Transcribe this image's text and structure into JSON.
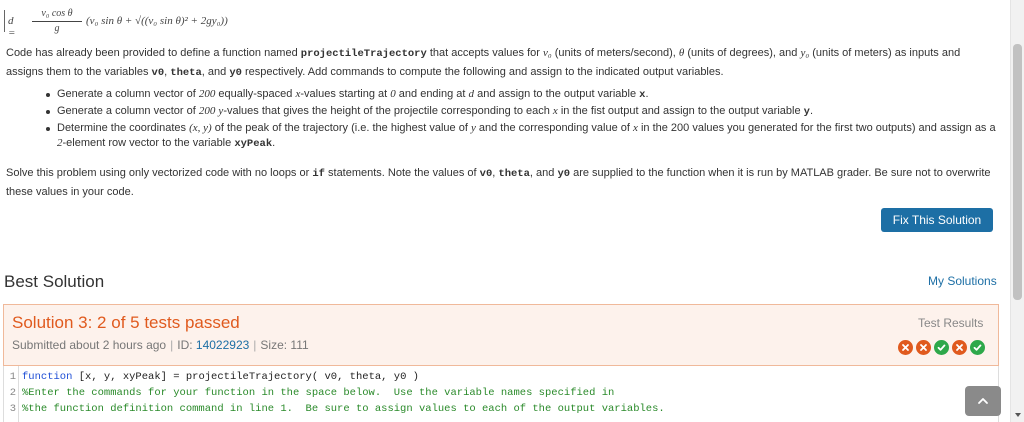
{
  "formula": {
    "lhs": "d =",
    "numerator": "v₀ cos θ",
    "denominator": "g",
    "rest": "(v₀ sin θ + √((v₀ sin θ)² + 2gy₀))"
  },
  "intro": {
    "t1": "Code has already been provided to define a function named ",
    "fname": "projectileTrajectory",
    "t2": " that accepts values for ",
    "m1": "v₀",
    "t3": " (units of meters/second), ",
    "m2": "θ",
    "t4": " (units of degrees), and ",
    "m3": "y₀",
    "t5": " (units of meters) as inputs and assigns them to the variables ",
    "c1": "v0",
    "t6": ", ",
    "c2": "theta",
    "t7": ", and ",
    "c3": "y0",
    "t8": " respectively.  Add commands to compute the following and assign to the indicated output variables."
  },
  "bullets": [
    {
      "a": "Generate a column vector of ",
      "m1": "200",
      "b": " equally-spaced ",
      "m2": "x",
      "c": "-values starting at ",
      "m3": "0",
      "d": " and ending at ",
      "m4": "d",
      "e": " and assign to the output variable ",
      "code": "x",
      "f": "."
    },
    {
      "a": "Generate a column vector of ",
      "m1": "200",
      "b": " ",
      "m2": "y",
      "c": "-values that gives the height of the projectile corresponding to each ",
      "m3": "x",
      "d": " in the fist output and assign to the output variable ",
      "code": "y",
      "f": "."
    },
    {
      "a": "Determine the coordinates ",
      "m1": "(x, y)",
      "b": " of the peak of the trajectory (i.e. the highest value of ",
      "m2": "y",
      "c": " and the corresponding value of ",
      "m3": "x",
      "d": " in the 200 values you generated for the first two outputs) and assign as a ",
      "m4": "2",
      "e": "-element row vector to the variable ",
      "code": "xyPeak",
      "f": "."
    }
  ],
  "solve": {
    "t1": "Solve this problem using only vectorized code with no loops or ",
    "c1": "if",
    "t2": " statements.  Note the values of ",
    "c2": "v0",
    "t3": ", ",
    "c3": "theta",
    "t4": ", and ",
    "c4": "y0",
    "t5": " are supplied to the function when it is run by MATLAB grader.  Be sure not to overwrite these values in your code."
  },
  "fix_button": "Fix This Solution",
  "best_solution_title": "Best Solution",
  "my_solutions_link": "My Solutions",
  "solution": {
    "title": "Solution 3: 2 of 5 tests passed",
    "submitted": "Submitted about 2 hours ago",
    "sep": "|",
    "id_label": "ID: ",
    "id_value": "14022923",
    "size": "Size: 111",
    "test_results_label": "Test Results",
    "tests": [
      "fail",
      "fail",
      "pass",
      "fail",
      "pass"
    ]
  },
  "code_lines": [
    {
      "num": "1",
      "kw": "function",
      "text": " [x, y, xyPeak] = projectileTrajectory( v0, theta, y0 )",
      "comment": ""
    },
    {
      "num": "2",
      "kw": "",
      "text": "",
      "comment": "%Enter the commands for your function in the space below.  Use the variable names specified in"
    },
    {
      "num": "3",
      "kw": "",
      "text": "",
      "comment": "%the function definition command in line 1.  Be sure to assign values to each of the output variables."
    }
  ],
  "colors": {
    "accent": "#1d6fa5",
    "fail": "#e05a1e",
    "pass": "#2ea84a",
    "solution_bg": "#fdf2ec"
  },
  "icons": {
    "fail_icon": "x-circle-icon",
    "pass_icon": "check-circle-icon",
    "scroll_top_icon": "chevron-up-icon"
  }
}
